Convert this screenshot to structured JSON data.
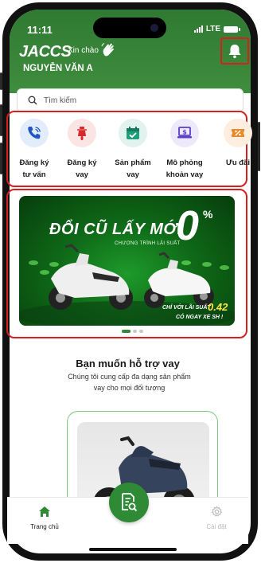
{
  "status_bar": {
    "time": "11:11",
    "network": "LTE"
  },
  "header": {
    "logo": "JACCS",
    "greeting": "Xin chào",
    "user_name": "NGUYỄN VĂN A",
    "bell_icon": "bell-icon"
  },
  "search": {
    "placeholder": "Tìm kiếm"
  },
  "quick_menu": [
    {
      "label_line1": "Đăng ký",
      "label_line2": "tư vấn",
      "icon": "phone-call-icon",
      "bg": "#e3ecfa"
    },
    {
      "label_line1": "Đăng ký",
      "label_line2": "vay",
      "icon": "scooter-icon",
      "bg": "#fbe5e4"
    },
    {
      "label_line1": "Sản phẩm",
      "label_line2": "vay",
      "icon": "calendar-check-icon",
      "bg": "#e2f3ef"
    },
    {
      "label_line1": "Mô phỏng",
      "label_line2": "khoản vay",
      "icon": "laptop-dollar-icon",
      "bg": "#eee8fb"
    },
    {
      "label_line1": "Ưu đãi",
      "label_line2": "",
      "icon": "voucher-icon",
      "bg": "#fdeee0"
    }
  ],
  "banner": {
    "title": "ĐỔI CŨ LẤY MỚI",
    "subtitle": "CHƯƠNG TRÌNH LÃI SUẤT",
    "zero": "0",
    "percent": "%",
    "rate_prefix": "CHỈ VỚI LÃI SUẤT",
    "rate_value": "0.42",
    "rate_suffix": "CÓ NGAY XE SH !",
    "carousel_active_index": 0,
    "carousel_count": 3
  },
  "section": {
    "title": "Bạn muốn hỗ trợ vay",
    "description": "Chúng tôi cung cấp đa dạng sản phẩm vay cho mọi đối tượng"
  },
  "bottom_nav": {
    "home_label": "Trang chủ",
    "settings_label": "Cài đặt"
  },
  "colors": {
    "brand_green": "#2f8a35",
    "header_green": "#3a8a3b",
    "highlight_red": "#d71f1f"
  }
}
